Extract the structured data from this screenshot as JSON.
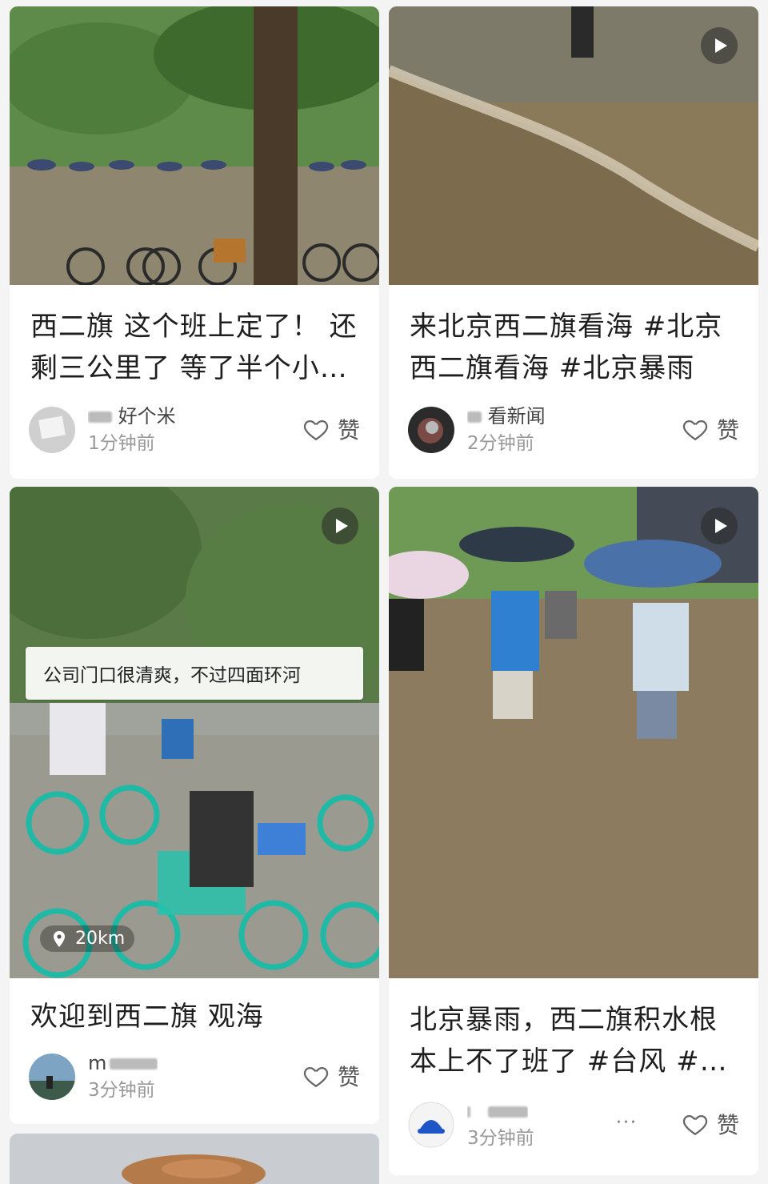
{
  "like_label": "赞",
  "cards": [
    {
      "title": "西二旗 这个班上定了！ 还剩三公里了 等了半个小…",
      "username_visible": "好个米",
      "time": "1分钟前",
      "is_video": false
    },
    {
      "title": "来北京西二旗看海 #北京西二旗看海 #北京暴雨",
      "username_visible": "看新闻",
      "time": "2分钟前",
      "is_video": true
    },
    {
      "title": "欢迎到西二旗 观海",
      "username_visible": "m",
      "time": "3分钟前",
      "is_video": true,
      "caption": "公司门口很清爽，不过四面环河",
      "distance": "20km"
    },
    {
      "title": "北京暴雨，西二旗积水根本上不了班了 #台风 #…",
      "username_visible": "",
      "time": "3分钟前",
      "is_video": true,
      "more": "···"
    }
  ],
  "colors": {
    "bg": "#f4f4f4",
    "card": "#ffffff",
    "title": "#1e1e1e",
    "muted": "#999999"
  }
}
